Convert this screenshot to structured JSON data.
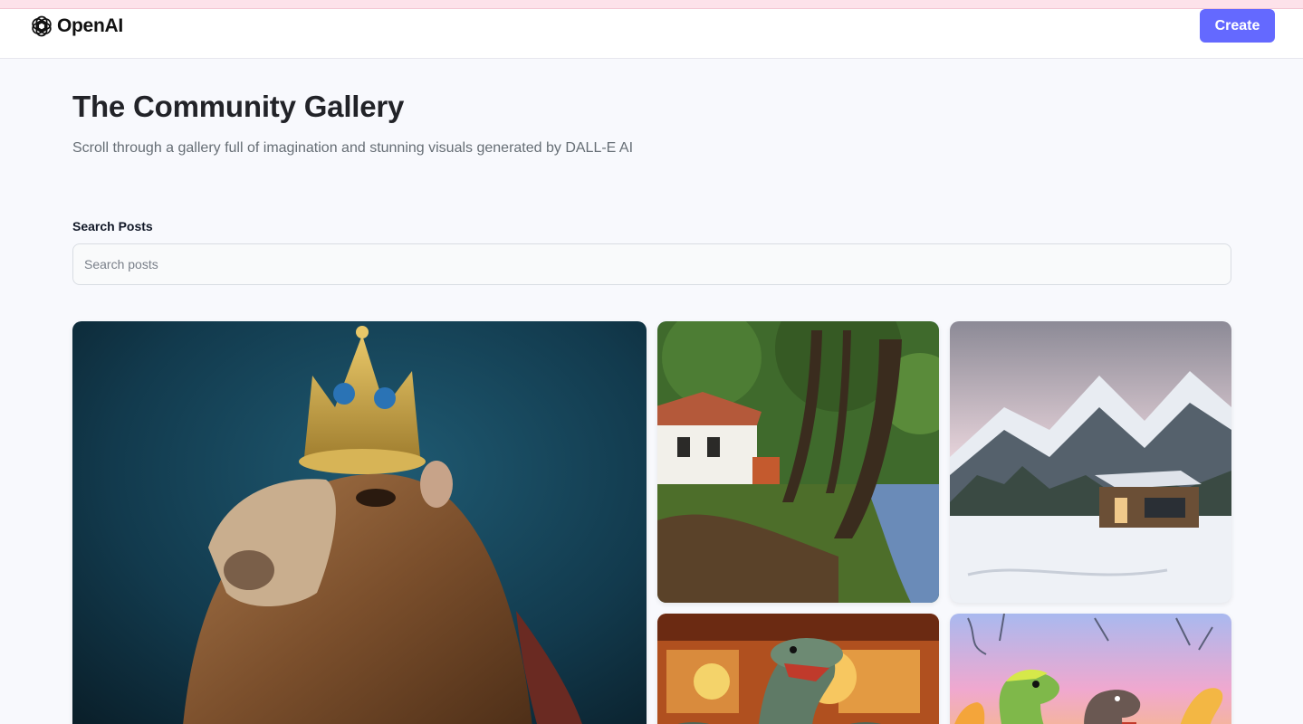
{
  "header": {
    "logo_text": "OpenAI",
    "create_label": "Create"
  },
  "hero": {
    "title": "The Community Gallery",
    "subtitle": "Scroll through a gallery full of imagination and stunning visuals generated by DALL-E AI"
  },
  "search": {
    "label": "Search Posts",
    "placeholder": "Search posts",
    "value": ""
  },
  "gallery": {
    "cards": [
      {
        "subject": "capybara-with-crown"
      },
      {
        "subject": "house-by-stream-in-forest"
      },
      {
        "subject": "snowy-mountain-cabin"
      },
      {
        "subject": "dinosaur-figurines-kitchen"
      },
      {
        "subject": "cartoon-dinosaurs"
      }
    ]
  },
  "colors": {
    "accent": "#6469ff",
    "background": "#f8f9fd",
    "title": "#222328",
    "subtitle": "#666e75"
  }
}
